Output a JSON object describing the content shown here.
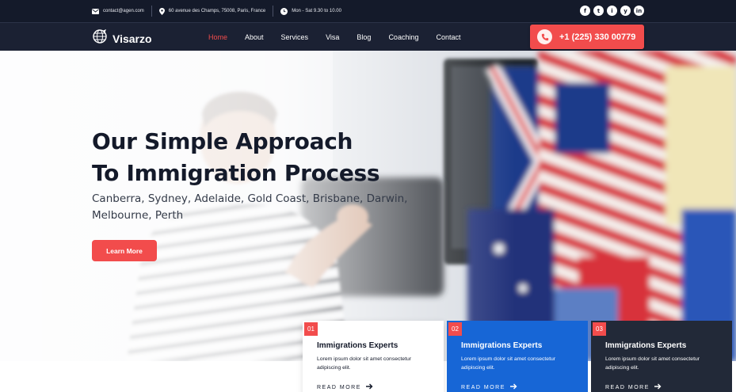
{
  "topbar": {
    "email": "contact@agen.com",
    "address": "60 avenue des Champs, 75008, Paris, France",
    "hours": "Mon - Sat 9.30 to 10.00",
    "socials": [
      "f",
      "t",
      "i",
      "y",
      "in"
    ]
  },
  "brand": {
    "name": "Visarzo"
  },
  "nav": {
    "items": [
      "Home",
      "About",
      "Services",
      "Visa",
      "Blog",
      "Coaching",
      "Contact"
    ],
    "active": "Home"
  },
  "phone": {
    "number": "+1 (225) 330 00779"
  },
  "hero": {
    "title_line1": "Our Simple Approach",
    "title_line2": "To Immigration Process",
    "subtitle": "Canberra, Sydney, Adelaide, Gold Coast, Brisbane, Darwin, Melbourne, Perth",
    "cta": "Learn More"
  },
  "cards": [
    {
      "num": "01",
      "title": "Immigrations Experts",
      "text": "Lorem ipsum dolor sit amet consectetur adipiscing elit.",
      "more": "READ MORE"
    },
    {
      "num": "02",
      "title": "Immigrations Experts",
      "text": "Lorem ipsum dolor sit amet consectetur adipiscing elit.",
      "more": "READ MORE"
    },
    {
      "num": "03",
      "title": "Immigrations Experts",
      "text": "Lorem ipsum dolor sit amet consectetur adipiscing elit.",
      "more": "READ MORE"
    }
  ],
  "colors": {
    "accent": "#f24c4c",
    "dark": "#141a2a",
    "blue": "#1766d6",
    "card_dark": "#222938"
  }
}
